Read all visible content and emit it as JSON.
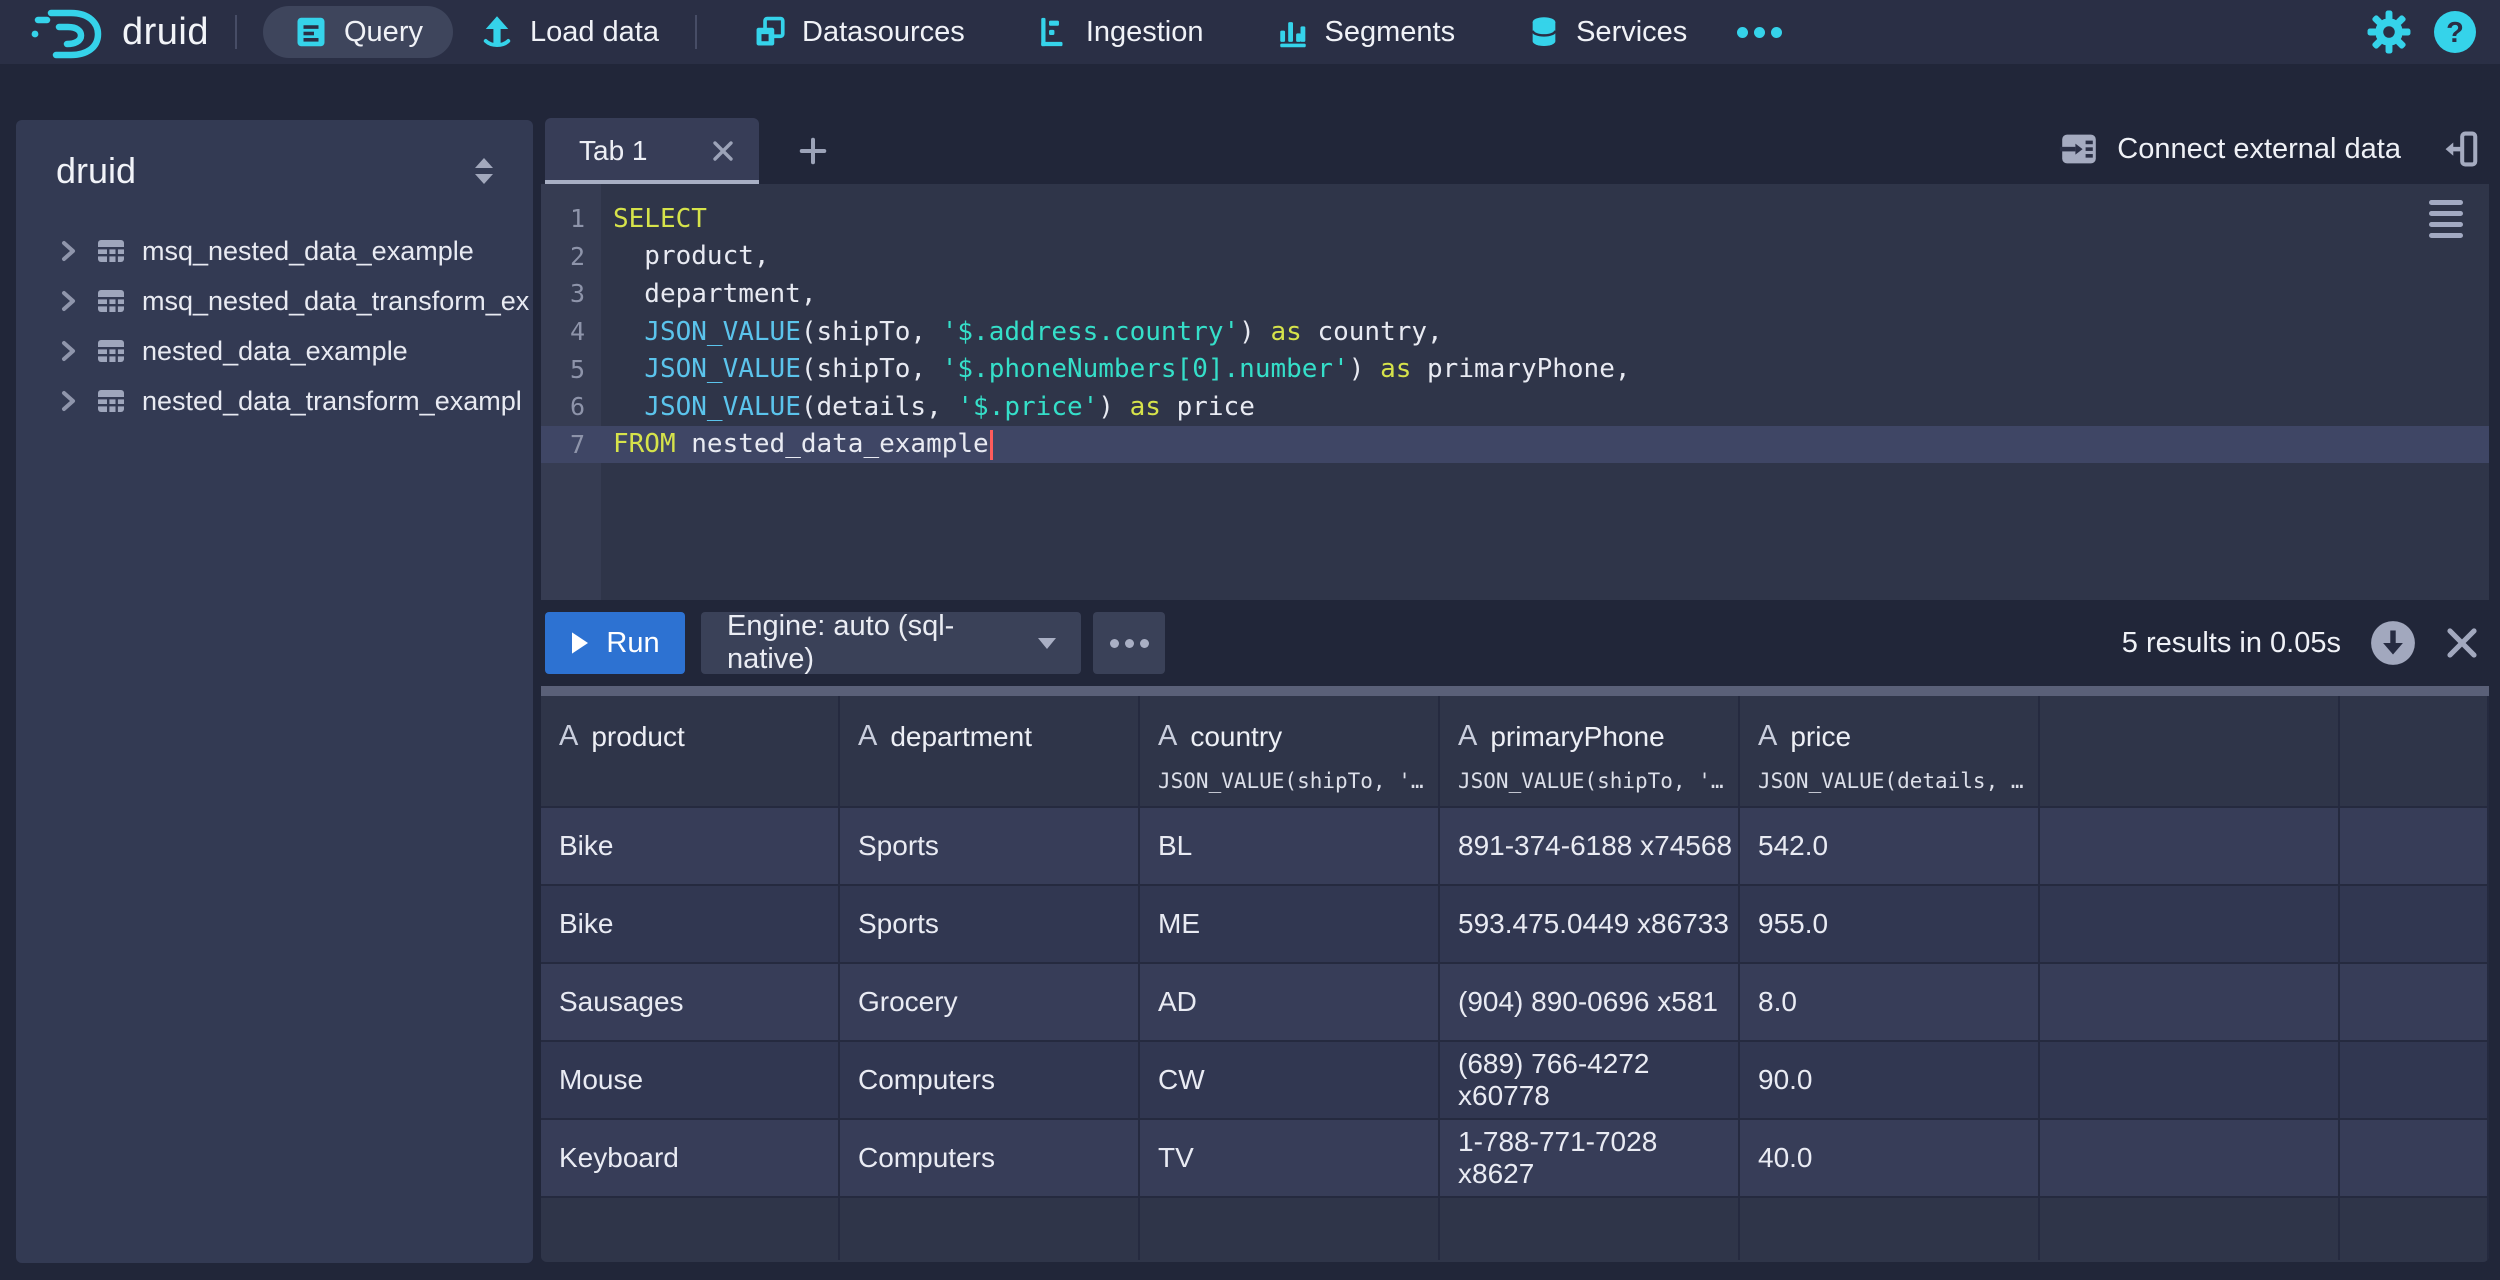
{
  "colors": {
    "accent_cyan": "#35D3EA",
    "run_button_blue": "#2D72D2",
    "keyword_yellow": "#D6E34A",
    "function_blue": "#5BC4EC",
    "string_teal": "#35DFC9",
    "cursor_red": "#FF5C5C",
    "navbar_bg": "#2A2F45",
    "panel_bg": "#333A53"
  },
  "nav": {
    "logo_text": "druid",
    "items": [
      {
        "label": "Query",
        "active": true
      },
      {
        "label": "Load data",
        "active": false
      },
      {
        "label": "Datasources",
        "active": false
      },
      {
        "label": "Ingestion",
        "active": false
      },
      {
        "label": "Segments",
        "active": false
      },
      {
        "label": "Services",
        "active": false
      }
    ]
  },
  "sidebar": {
    "title": "druid",
    "items": [
      {
        "label": "msq_nested_data_example"
      },
      {
        "label": "msq_nested_data_transform_ex"
      },
      {
        "label": "nested_data_example"
      },
      {
        "label": "nested_data_transform_exampl"
      }
    ]
  },
  "tabs": {
    "items": [
      {
        "label": "Tab 1"
      }
    ],
    "connect_external_label": "Connect external data"
  },
  "editor": {
    "cursor_line": 7,
    "lines": [
      {
        "n": "1",
        "tokens": [
          {
            "t": "kw",
            "v": "SELECT"
          }
        ]
      },
      {
        "n": "2",
        "tokens": [
          {
            "t": "txt",
            "v": "  product,"
          }
        ]
      },
      {
        "n": "3",
        "tokens": [
          {
            "t": "txt",
            "v": "  department,"
          }
        ]
      },
      {
        "n": "4",
        "tokens": [
          {
            "t": "txt",
            "v": "  "
          },
          {
            "t": "fn",
            "v": "JSON_VALUE"
          },
          {
            "t": "txt",
            "v": "(shipTo, "
          },
          {
            "t": "str",
            "v": "'$.address.country'"
          },
          {
            "t": "txt",
            "v": ") "
          },
          {
            "t": "kw",
            "v": "as"
          },
          {
            "t": "txt",
            "v": " country,"
          }
        ]
      },
      {
        "n": "5",
        "tokens": [
          {
            "t": "txt",
            "v": "  "
          },
          {
            "t": "fn",
            "v": "JSON_VALUE"
          },
          {
            "t": "txt",
            "v": "(shipTo, "
          },
          {
            "t": "str",
            "v": "'$.phoneNumbers[0].number'"
          },
          {
            "t": "txt",
            "v": ") "
          },
          {
            "t": "kw",
            "v": "as"
          },
          {
            "t": "txt",
            "v": " primaryPhone,"
          }
        ]
      },
      {
        "n": "6",
        "tokens": [
          {
            "t": "txt",
            "v": "  "
          },
          {
            "t": "fn",
            "v": "JSON_VALUE"
          },
          {
            "t": "txt",
            "v": "(details, "
          },
          {
            "t": "str",
            "v": "'$.price'"
          },
          {
            "t": "txt",
            "v": ") "
          },
          {
            "t": "kw",
            "v": "as"
          },
          {
            "t": "txt",
            "v": " price"
          }
        ]
      },
      {
        "n": "7",
        "tokens": [
          {
            "t": "kw",
            "v": "FROM"
          },
          {
            "t": "txt",
            "v": " nested_data_example"
          }
        ]
      }
    ]
  },
  "runbar": {
    "run_label": "Run",
    "engine_label": "Engine: auto (sql-native)",
    "results_info": "5 results in 0.05s"
  },
  "results": {
    "columns": [
      {
        "type": "string",
        "name": "product",
        "subtext": ""
      },
      {
        "type": "string",
        "name": "department",
        "subtext": ""
      },
      {
        "type": "string",
        "name": "country",
        "subtext": "JSON_VALUE(shipTo, '…"
      },
      {
        "type": "string",
        "name": "primaryPhone",
        "subtext": "JSON_VALUE(shipTo, '…"
      },
      {
        "type": "string",
        "name": "price",
        "subtext": "JSON_VALUE(details, …"
      }
    ],
    "rows": [
      [
        "Bike",
        "Sports",
        "BL",
        "891-374-6188 x74568",
        "542.0"
      ],
      [
        "Bike",
        "Sports",
        "ME",
        "593.475.0449 x86733",
        "955.0"
      ],
      [
        "Sausages",
        "Grocery",
        "AD",
        "(904) 890-0696 x581",
        "8.0"
      ],
      [
        "Mouse",
        "Computers",
        "CW",
        "(689) 766-4272 x60778",
        "90.0"
      ],
      [
        "Keyboard",
        "Computers",
        "TV",
        "1-788-771-7028 x8627",
        "40.0"
      ]
    ],
    "empty_trailing_columns": 2
  }
}
